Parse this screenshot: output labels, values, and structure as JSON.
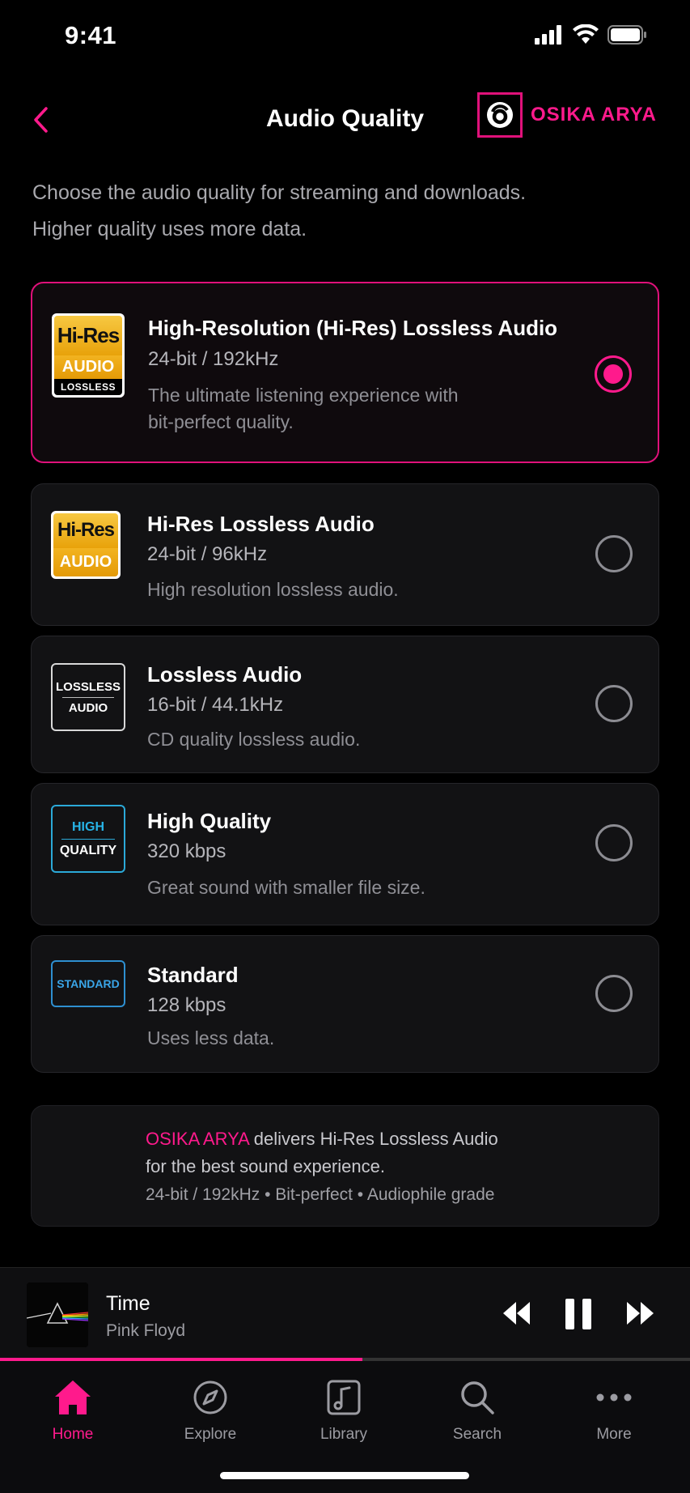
{
  "status_bar": {
    "time": "9:41"
  },
  "header": {
    "title": "Audio Quality",
    "brand": "OSIKA ARYA"
  },
  "intro": {
    "line1": "Choose the audio quality for streaming and downloads.",
    "line2": "Higher quality uses more data."
  },
  "options": [
    {
      "title": "High-Resolution (Hi-Res) Lossless Audio",
      "spec": "24-bit / 192kHz",
      "desc_line1": "The ultimate listening experience with",
      "desc_line2": "bit-perfect quality.",
      "selected": true,
      "badge": {
        "top": "Hi-Res",
        "mid": "AUDIO",
        "bot": "LOSSLESS"
      }
    },
    {
      "title": "Hi-Res Lossless Audio",
      "spec": "24-bit / 96kHz",
      "desc_line1": "High resolution lossless audio.",
      "selected": false,
      "badge": {
        "top": "Hi-Res",
        "mid": "AUDIO"
      }
    },
    {
      "title": "Lossless Audio",
      "spec": "16-bit / 44.1kHz",
      "desc_line1": "CD quality lossless audio.",
      "selected": false,
      "badge": {
        "top": "LOSSLESS",
        "bot": "AUDIO"
      }
    },
    {
      "title": "High Quality",
      "spec": "320 kbps",
      "desc_line1": "Great sound with smaller file size.",
      "selected": false,
      "badge": {
        "top": "HIGH",
        "bot": "QUALITY"
      }
    },
    {
      "title": "Standard",
      "spec": "128 kbps",
      "desc_line1": "Uses less data.",
      "selected": false,
      "badge": {
        "top": "STANDARD"
      }
    }
  ],
  "info": {
    "brand": "OSIKA ARYA",
    "line1_rest": " delivers Hi-Res Lossless Audio",
    "line2": "for the best sound experience.",
    "line3": "24-bit / 192kHz • Bit-perfect • Audiophile grade"
  },
  "player": {
    "song": "Time",
    "artist": "Pink Floyd",
    "progress": 0.525
  },
  "tabs": [
    {
      "label": "Home",
      "icon": "home-icon",
      "active": true
    },
    {
      "label": "Explore",
      "icon": "compass-icon",
      "active": false
    },
    {
      "label": "Library",
      "icon": "music-library-icon",
      "active": false
    },
    {
      "label": "Search",
      "icon": "search-icon",
      "active": false
    },
    {
      "label": "More",
      "icon": "more-icon",
      "active": false
    }
  ],
  "colors": {
    "accent": "#ff1a8c",
    "background": "#000000",
    "card": "#121214"
  }
}
